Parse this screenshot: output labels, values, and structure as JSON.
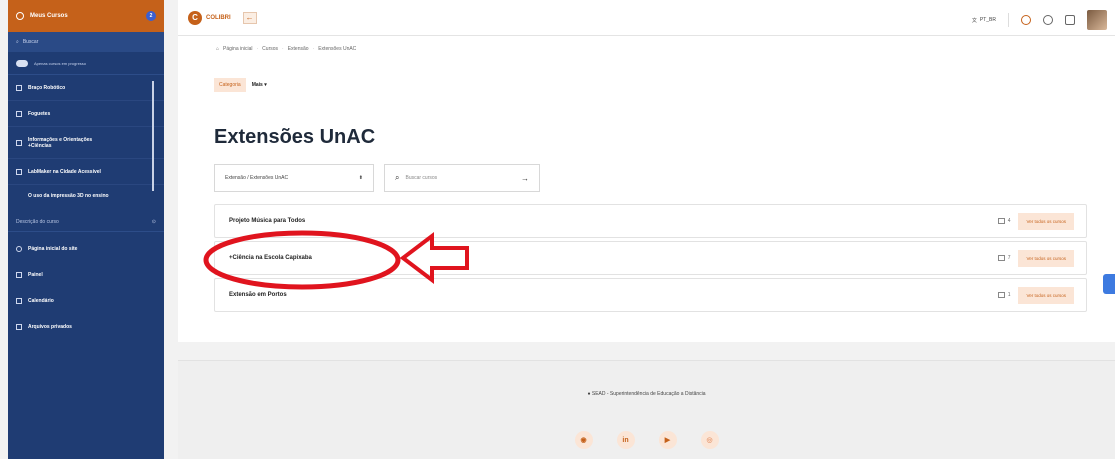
{
  "sidebar": {
    "header_label": "Meus Cursos",
    "badge": "2",
    "search_placeholder": "Buscar",
    "toggle_label": "Apenas cursos em progresso",
    "courses": [
      {
        "label": "Braço Robótico"
      },
      {
        "label": "Foguetes"
      },
      {
        "label": "Informações e Orientações +Ciências"
      },
      {
        "label": "LabMaker na Cidade Acessível"
      },
      {
        "label": "O uso da impressão 3D no ensino"
      }
    ],
    "description_label": "Descrição do curso",
    "nav": [
      {
        "label": "Página inicial do site"
      },
      {
        "label": "Painel"
      },
      {
        "label": "Calendário"
      },
      {
        "label": "Arquivos privados"
      }
    ]
  },
  "topbar": {
    "logo_letter": "C",
    "logo_text": "COLIBRI",
    "collapse_glyph": "←",
    "language": "PT_BR"
  },
  "breadcrumb": [
    "Página inicial",
    "Cursos",
    "Extensão",
    "Extensões UnAC"
  ],
  "tabs": {
    "category": "Categoria",
    "more": "Mais ▾"
  },
  "page_title": "Extensões UnAC",
  "filters": {
    "select_value": "Extensão / Extensões UnAC",
    "select_arrow": "⬍",
    "search_placeholder": "Buscar cursos",
    "search_arrow": "→"
  },
  "courses": [
    {
      "name": "Projeto Música para Todos",
      "count": "4",
      "button": "Ver todos os cursos"
    },
    {
      "name": "+Ciência na Escola Capixaba",
      "count": "7",
      "button": "Ver todos os cursos"
    },
    {
      "name": "Extensão em Portos",
      "count": "1",
      "button": "Ver todos os cursos"
    }
  ],
  "annotation": {
    "color": "#e0141e"
  },
  "footer": {
    "text": "SEAD - Superintendência de Educação a Distância",
    "socials": [
      {
        "icon": "web-icon",
        "glyph": "◉"
      },
      {
        "icon": "linkedin-icon",
        "glyph": "in"
      },
      {
        "icon": "youtube-icon",
        "glyph": "▶"
      },
      {
        "icon": "instagram-icon",
        "glyph": "◎"
      }
    ]
  },
  "colors": {
    "brand": "#c5611a",
    "sidebar": "#1f3c73",
    "accent_light": "#fbe5d6"
  }
}
